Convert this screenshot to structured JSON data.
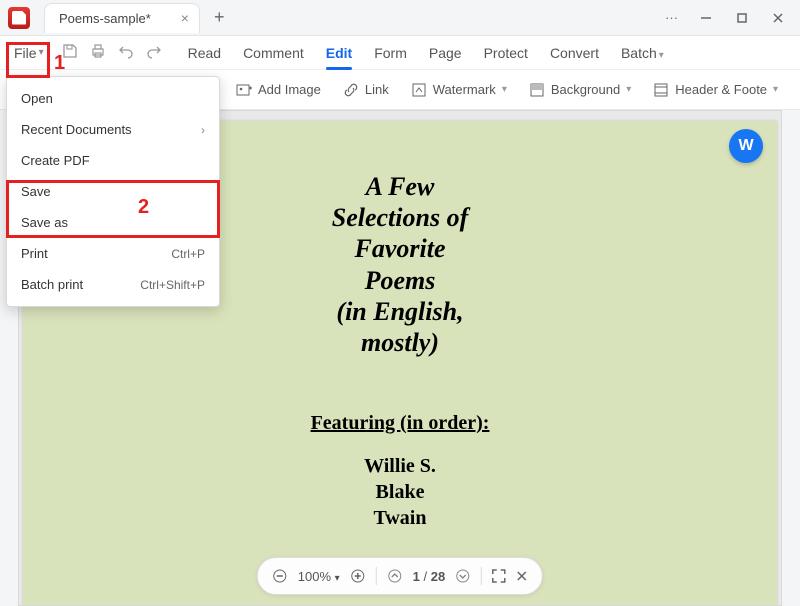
{
  "tab": {
    "title": "Poems-sample*"
  },
  "menubar": {
    "file": "File",
    "items": [
      "Read",
      "Comment",
      "Edit",
      "Form",
      "Page",
      "Protect",
      "Convert",
      "Batch"
    ],
    "active_index": 2
  },
  "toolbar2": {
    "add_image": "Add Image",
    "link": "Link",
    "watermark": "Watermark",
    "background": "Background",
    "header_footer": "Header & Foote"
  },
  "file_menu": {
    "open": "Open",
    "recent": "Recent Documents",
    "create_pdf": "Create PDF",
    "save": "Save",
    "save_as": "Save as",
    "print": "Print",
    "print_shortcut": "Ctrl+P",
    "batch_print": "Batch print",
    "batch_print_shortcut": "Ctrl+Shift+P"
  },
  "page_content": {
    "line1": "A Few",
    "line2": "Selections of",
    "line3": "Favorite",
    "line4": "Poems",
    "line5": "(in English,",
    "line6": "mostly)",
    "featuring": "Featuring (in order):",
    "name1": "Willie S.",
    "name2": "Blake",
    "name3": "Twain"
  },
  "zoom_bar": {
    "percent": "100%",
    "page_current": "1",
    "page_sep": " / ",
    "page_total": "28"
  },
  "word_badge": "W",
  "annotations": {
    "one": "1",
    "two": "2"
  },
  "ellipsis": "···"
}
